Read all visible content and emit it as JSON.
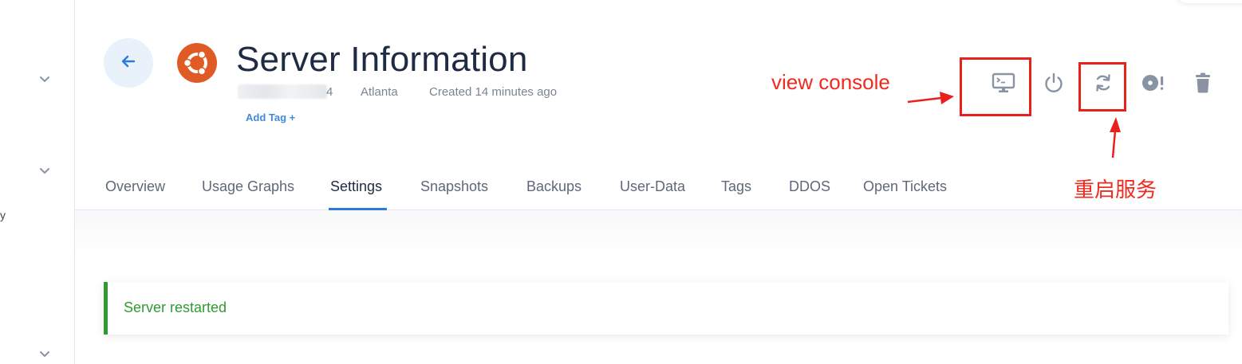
{
  "header": {
    "title": "Server Information",
    "ip_suffix": "4",
    "location": "Atlanta",
    "created": "Created 14 minutes ago",
    "add_tag": "Add Tag +"
  },
  "tabs": [
    {
      "label": "Overview"
    },
    {
      "label": "Usage Graphs"
    },
    {
      "label": "Settings",
      "active": true
    },
    {
      "label": "Snapshots"
    },
    {
      "label": "Backups"
    },
    {
      "label": "User-Data"
    },
    {
      "label": "Tags"
    },
    {
      "label": "DDOS"
    },
    {
      "label": "Open Tickets"
    }
  ],
  "annotations": {
    "console": "view console",
    "restart": "重启服务"
  },
  "alert": {
    "message": "Server restarted"
  },
  "sidebar": {
    "mark": "y"
  },
  "icons": {
    "back": "arrow-left-icon",
    "os": "ubuntu-logo",
    "console": "monitor-terminal-icon",
    "power": "power-icon",
    "restart": "refresh-icon",
    "iso": "disc-alert-icon",
    "delete": "trash-icon"
  },
  "colors": {
    "accent": "#2b7bd8",
    "annotation_red": "#e8211c",
    "success": "#2e9b33",
    "ubuntu_orange": "#e05a25",
    "icon_gray": "#8a93a3"
  }
}
